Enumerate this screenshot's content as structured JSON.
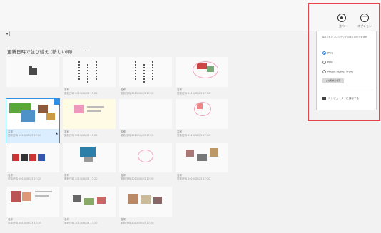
{
  "header": {
    "back_glyph": "•("
  },
  "toolbar": {
    "sort_label": "並べ",
    "options_label": "オプション"
  },
  "page": {
    "title": "更新日時で並び替え (新しい順)",
    "title_caret": "⌄"
  },
  "tiles": [
    {
      "name": "",
      "date": ""
    },
    {
      "name": "名称",
      "date": "更新日時 2013/08/23 17:20"
    },
    {
      "name": "名称",
      "date": "更新日時 2013/08/23 17:20"
    },
    {
      "name": "名称",
      "date": "更新日時 2013/08/23 17:20"
    },
    {
      "name": "名称",
      "date": "更新日時 2013/08/23 17:20"
    },
    {
      "name": "名称",
      "date": "更新日時 2013/08/23 17:20"
    },
    {
      "name": "名称",
      "date": "更新日時 2013/08/23 17:20"
    },
    {
      "name": "名称",
      "date": "更新日時 2013/08/23 17:20"
    },
    {
      "name": "名称",
      "date": "更新日時 2013/08/23 17:20"
    },
    {
      "name": "名称",
      "date": "更新日時 2013/08/23 17:20"
    },
    {
      "name": "名称",
      "date": "更新日時 2013/08/23 17:20"
    },
    {
      "name": "名称",
      "date": "更新日時 2013/08/23 17:20"
    },
    {
      "name": "名称",
      "date": "更新日時 2013/08/23 17:20"
    },
    {
      "name": "名称",
      "date": "更新日時 2013/08/23 17:20"
    },
    {
      "name": "名称",
      "date": "更新日時 2013/08/23 17:20"
    }
  ],
  "options": {
    "description": "保存されたプロジェクトの既定の形式を選択",
    "formats": [
      "JPEG",
      "PNG",
      "Adobe Reader (PDF)"
    ],
    "set_default": "この形式で保存",
    "add_to_pc": "コンピューターに保存する"
  },
  "colors": {
    "selection": "#2f8fe6",
    "highlight": "#e8434c"
  }
}
